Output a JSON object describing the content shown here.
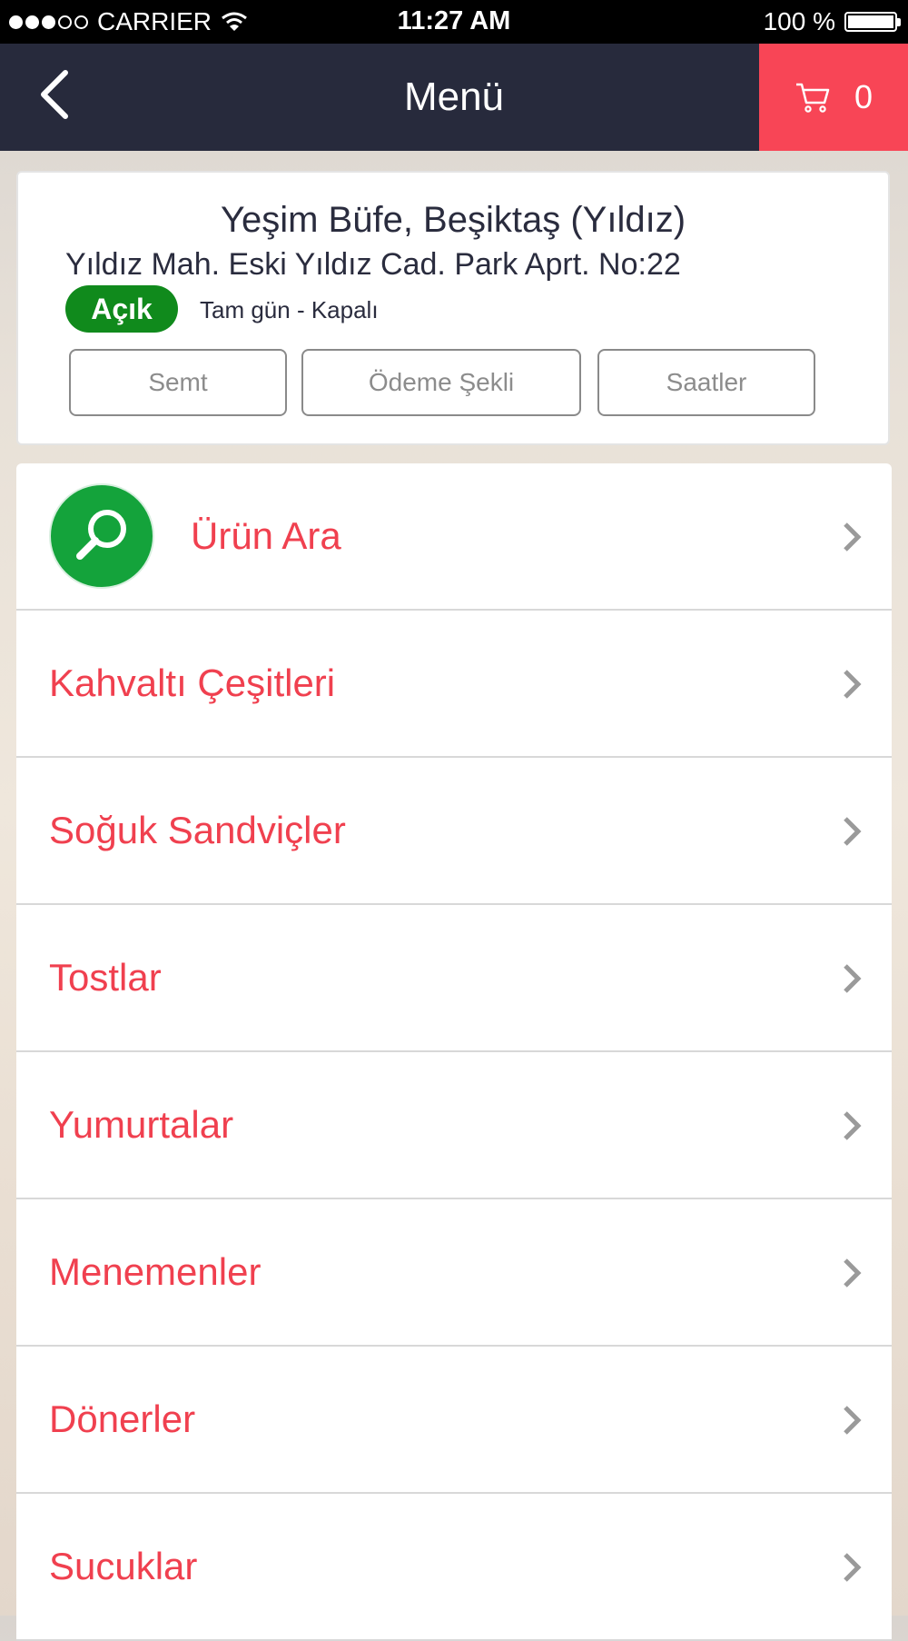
{
  "status_bar": {
    "carrier": "CARRIER",
    "time": "11:27 AM",
    "battery": "100 %",
    "signal_icon": "signal-dots-icon",
    "wifi_icon": "wifi-icon",
    "battery_icon": "battery-icon"
  },
  "navbar": {
    "title": "Menü",
    "back_icon": "chevron-left-icon",
    "cart_icon": "cart-icon",
    "cart_count": "0",
    "cart_color": "#f84556",
    "bg_color": "#272a3c"
  },
  "restaurant": {
    "name": "Yeşim Büfe, Beşiktaş (Yıldız)",
    "address": "Yıldız Mah. Eski Yıldız Cad. Park Aprt. No:22",
    "status": "Açık",
    "status_color": "#108a1c",
    "hours": "Tam gün - Kapalı",
    "buttons": [
      "Semt",
      "Ödeme Şekli",
      "Saatler"
    ]
  },
  "menu": {
    "search_label": "Ürün Ara",
    "search_icon": "search-icon",
    "item_color": "#f0404f",
    "categories": [
      "Kahvaltı Çeşitleri",
      "Soğuk Sandviçler",
      "Tostlar",
      "Yumurtalar",
      "Menemenler",
      "Dönerler",
      "Sucuklar"
    ]
  }
}
